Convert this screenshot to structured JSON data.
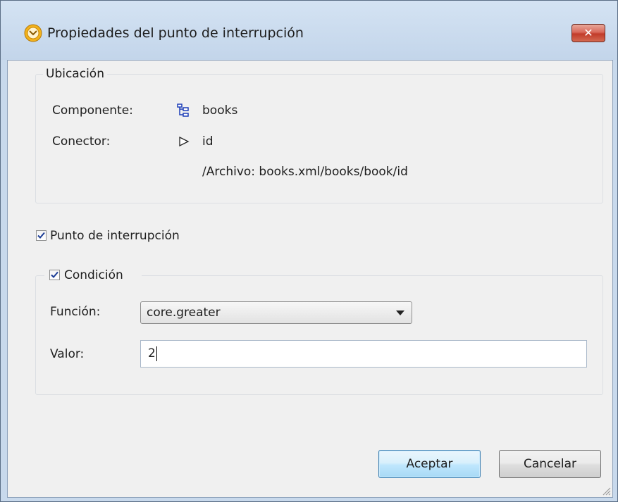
{
  "window": {
    "title": "Propiedades del punto de interrupción",
    "close_label": "✕",
    "icon": "breakpoint-clock-icon"
  },
  "location": {
    "group_label": "Ubicación",
    "component_label": "Componente:",
    "component_value": "books",
    "component_icon": "xml-tree-icon",
    "connector_label": "Conector:",
    "connector_value": "id",
    "connector_icon": "output-triangle-icon",
    "path": "/Archivo: books.xml/books/book/id"
  },
  "breakpoint": {
    "label": "Punto de interrupción",
    "checked": true
  },
  "condition": {
    "label": "Condición",
    "checked": true,
    "function_label": "Función:",
    "function_value": "core.greater",
    "value_label": "Valor:",
    "value": "2"
  },
  "buttons": {
    "ok_label": "Aceptar",
    "cancel_label": "Cancelar"
  }
}
